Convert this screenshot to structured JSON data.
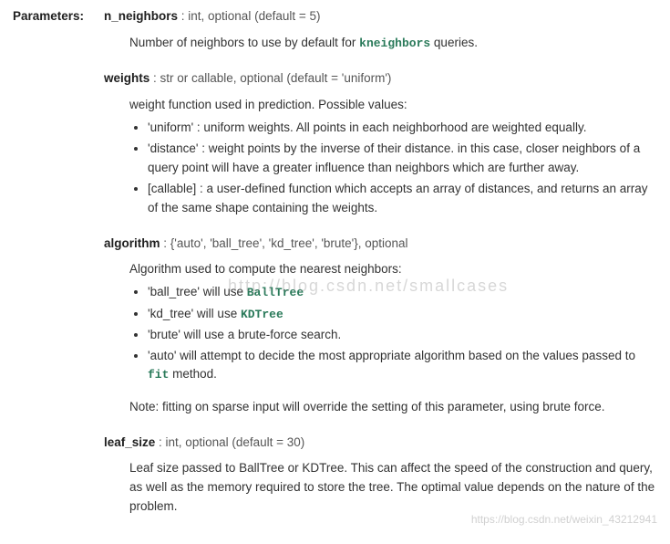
{
  "labels": {
    "parameters": "Parameters:"
  },
  "params": {
    "n_neighbors": {
      "name": "n_neighbors",
      "type": " : int, optional (default = 5)",
      "desc_pre": "Number of neighbors to use by default for ",
      "code": "kneighbors",
      "desc_post": " queries."
    },
    "weights": {
      "name": "weights",
      "type": " : str or callable, optional (default = 'uniform')",
      "intro": "weight function used in prediction. Possible values:",
      "opt1": "'uniform' : uniform weights. All points in each neighborhood are weighted equally.",
      "opt2": "'distance' : weight points by the inverse of their distance. in this case, closer neighbors of a query point will have a greater influence than neighbors which are further away.",
      "opt3": "[callable] : a user-defined function which accepts an array of distances, and returns an array of the same shape containing the weights."
    },
    "algorithm": {
      "name": "algorithm",
      "type": " : {'auto', 'ball_tree', 'kd_tree', 'brute'}, optional",
      "intro": "Algorithm used to compute the nearest neighbors:",
      "opt1_pre": "'ball_tree' will use ",
      "opt1_code": "BallTree",
      "opt2_pre": "'kd_tree' will use ",
      "opt2_code": "KDTree",
      "opt3": "'brute' will use a brute-force search.",
      "opt4_pre": "'auto' will attempt to decide the most appropriate algorithm based on the values passed to ",
      "opt4_code": "fit",
      "opt4_post": " method.",
      "note": "Note: fitting on sparse input will override the setting of this parameter, using brute force."
    },
    "leaf_size": {
      "name": "leaf_size",
      "type": " : int, optional (default = 30)",
      "desc": "Leaf size passed to BallTree or KDTree. This can affect the speed of the construction and query, as well as the memory required to store the tree. The optimal value depends on the nature of the problem."
    }
  },
  "watermarks": {
    "center": "http://blog.csdn.net/smallcases",
    "corner": "https://blog.csdn.net/weixin_43212941"
  }
}
